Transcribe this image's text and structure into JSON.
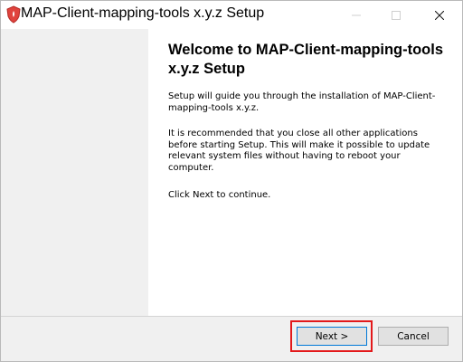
{
  "window": {
    "title": "MAP-Client-mapping-tools x.y.z Setup",
    "app_icon": "installer-shield-icon"
  },
  "content": {
    "heading": "Welcome to MAP-Client-mapping-tools x.y.z Setup",
    "paragraph1": "Setup will guide you through the installation of MAP-Client-mapping-tools x.y.z.",
    "paragraph2": "It is recommended that you close all other applications before starting Setup. This will make it possible to update relevant system files without having to reboot your computer.",
    "paragraph3": "Click Next to continue."
  },
  "buttons": {
    "next_label": "Next >",
    "cancel_label": "Cancel"
  },
  "colors": {
    "highlight": "#e3191b",
    "focus_border": "#0078d7",
    "panel_bg": "#f0f0f0",
    "icon_red": "#e0433d"
  }
}
